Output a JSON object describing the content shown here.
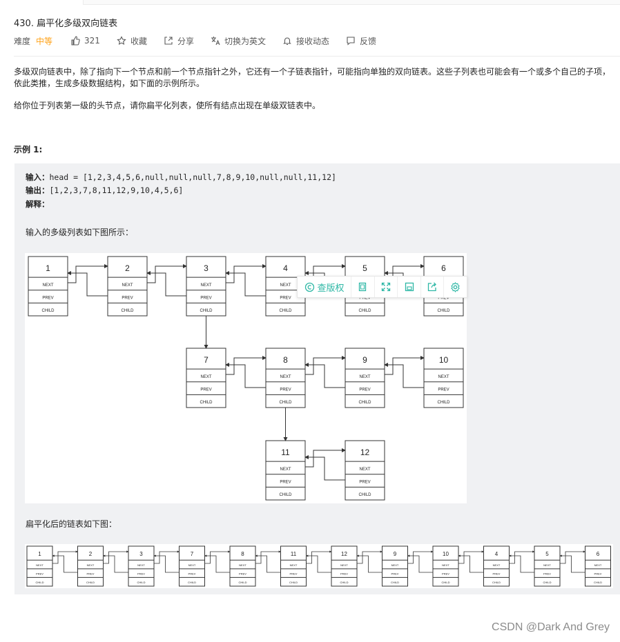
{
  "problem": {
    "title": "430. 扁平化多级双向链表",
    "difficulty_label": "难度",
    "difficulty_value": "中等",
    "likes": "321",
    "favorite": "收藏",
    "share": "分享",
    "switch_lang": "切换为英文",
    "subscribe": "接收动态",
    "feedback": "反馈"
  },
  "description": {
    "p1": "多级双向链表中，除了指向下一个节点和前一个节点指针之外，它还有一个子链表指针，可能指向单独的双向链表。这些子列表也可能会有一个或多个自己的子项，依此类推，生成多级数据结构，如下面的示例所示。",
    "p2": "给你位于列表第一级的头节点，请你扁平化列表，使所有结点出现在单级双链表中。"
  },
  "example": {
    "title": "示例 1:",
    "input_label": "输入：",
    "input_value": "head = [1,2,3,4,5,6,null,null,null,7,8,9,10,null,null,11,12]",
    "output_label": "输出：",
    "output_value": "[1,2,3,7,8,11,12,9,10,4,5,6]",
    "explain_label": "解释：",
    "line_multi": "输入的多级列表如下图所示：",
    "line_flat": "扁平化后的链表如下图："
  },
  "diagram": {
    "field_next": "NEXT",
    "field_prev": "PREV",
    "field_child": "CHILD",
    "level1": [
      "1",
      "2",
      "3",
      "4",
      "5",
      "6"
    ],
    "level2": [
      "7",
      "8",
      "9",
      "10"
    ],
    "level3": [
      "11",
      "12"
    ],
    "flattened": [
      "1",
      "2",
      "3",
      "7",
      "8",
      "11",
      "12",
      "9",
      "10",
      "4",
      "5",
      "6"
    ]
  },
  "image_toolbar": {
    "copyright": "查版权",
    "icons": [
      "copy-icon",
      "expand-icon",
      "save-icon",
      "share-icon",
      "settings-icon"
    ]
  },
  "watermark": "CSDN @Dark And Grey",
  "colors": {
    "difficulty": "#ffa116",
    "toolbar_accent": "#2db7a5",
    "code_bg": "#f0f1f3"
  }
}
